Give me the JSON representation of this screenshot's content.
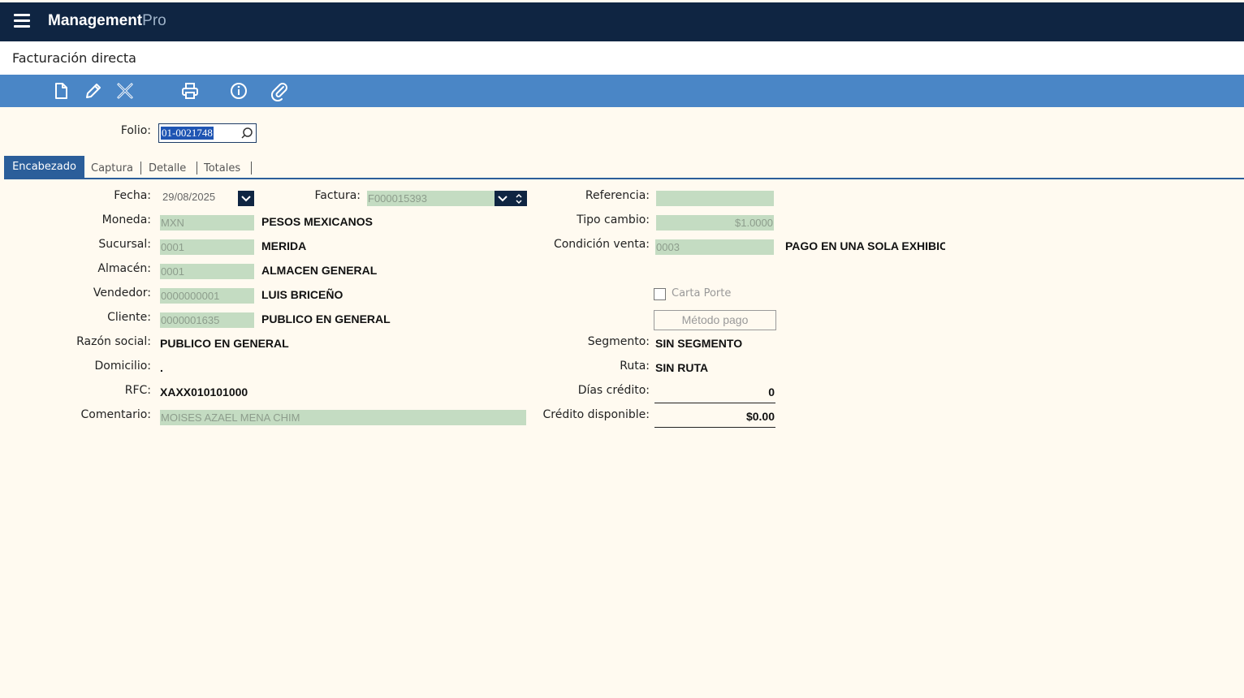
{
  "app": {
    "brand_bold": "Management",
    "brand_light": "Pro"
  },
  "page": {
    "title": "Facturación directa"
  },
  "toolbar": {
    "icons": [
      "new-document-icon",
      "edit-pencil-icon",
      "delete-x-icon",
      "print-icon",
      "info-icon",
      "attach-paperclip-icon"
    ]
  },
  "folio": {
    "label": "Folio:",
    "value": "01-0021748"
  },
  "tabs": [
    {
      "label": "Encabezado",
      "active": true
    },
    {
      "label": "Captura"
    },
    {
      "label": "Detalle"
    },
    {
      "label": "Totales"
    }
  ],
  "form": {
    "fecha": {
      "label": "Fecha:",
      "value": "29/08/2025"
    },
    "factura": {
      "label": "Factura:",
      "value": "F000015393"
    },
    "referencia": {
      "label": "Referencia:",
      "value": ""
    },
    "moneda": {
      "label": "Moneda:",
      "code": "MXN",
      "name": "PESOS MEXICANOS"
    },
    "tipo_cambio": {
      "label": "Tipo cambio:",
      "value": "$1.0000"
    },
    "sucursal": {
      "label": "Sucursal:",
      "code": "0001",
      "name": "MERIDA"
    },
    "condicion_venta": {
      "label": "Condición venta:",
      "code": "0003",
      "name": "PAGO EN UNA SOLA EXHIBICIÓI"
    },
    "almacen": {
      "label": "Almacén:",
      "code": "0001",
      "name": "ALMACEN GENERAL"
    },
    "vendedor": {
      "label": "Vendedor:",
      "code": "0000000001",
      "name": "LUIS BRICEÑO"
    },
    "carta_porte": {
      "label": "Carta Porte",
      "checked": false
    },
    "cliente": {
      "label": "Cliente:",
      "code": "0000001635",
      "name": "PUBLICO EN GENERAL"
    },
    "metodo_pago": {
      "label": "Método pago"
    },
    "razon_social": {
      "label": "Razón social:",
      "value": "PUBLICO EN GENERAL"
    },
    "segmento": {
      "label": "Segmento:",
      "value": "SIN SEGMENTO"
    },
    "domicilio": {
      "label": "Domicilio:",
      "value": "."
    },
    "ruta": {
      "label": "Ruta:",
      "value": "SIN RUTA"
    },
    "rfc": {
      "label": "RFC:",
      "value": "XAXX010101000"
    },
    "dias_credito": {
      "label": "Días crédito:",
      "value": "0"
    },
    "comentario": {
      "label": "Comentario:",
      "value": "MOISES AZAEL MENA CHIM"
    },
    "credito_disponible": {
      "label": "Crédito disponible:",
      "value": "$0.00"
    }
  },
  "colors": {
    "topbar": "#0f2542",
    "toolbar": "#4a86c6",
    "tab_active": "#2b5e9a",
    "field_bg": "#c4dcc2",
    "page_bg": "#fffaf0"
  }
}
